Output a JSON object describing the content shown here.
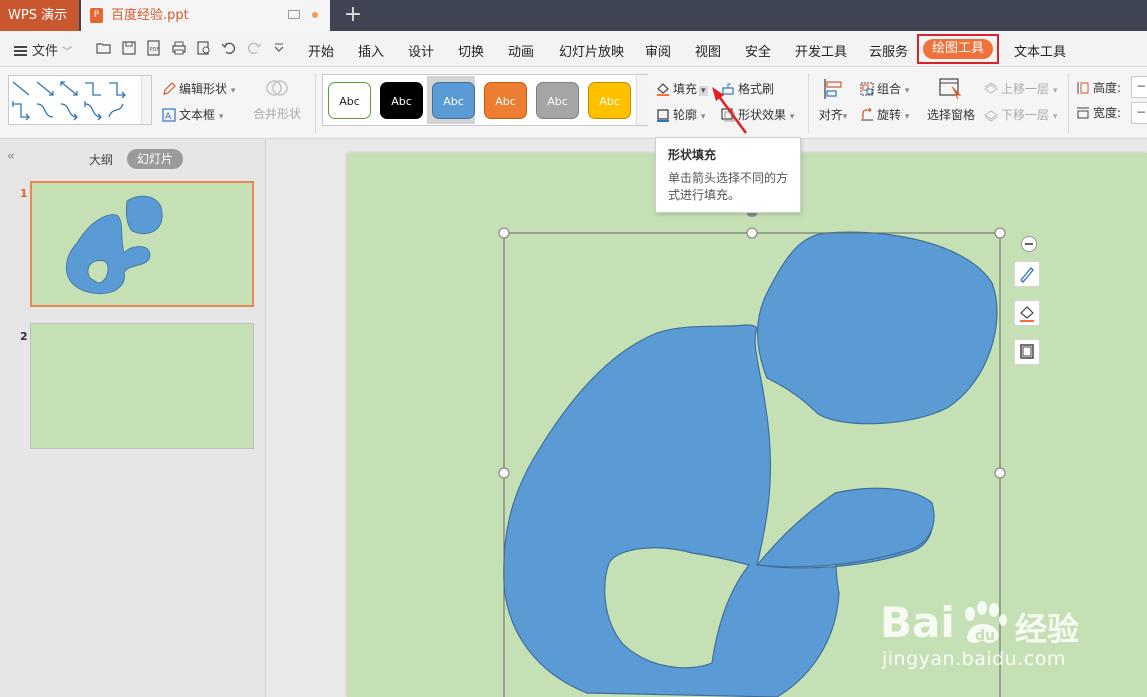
{
  "titlebar": {
    "app_name": "WPS 演示",
    "document_tab": "百度经验.ppt",
    "new_tab": "+"
  },
  "menubar": {
    "file": "文件",
    "items": [
      "开始",
      "插入",
      "设计",
      "切换",
      "动画",
      "幻灯片放映",
      "审阅",
      "视图",
      "安全",
      "开发工具",
      "云服务"
    ],
    "active_tab": "绘图工具",
    "after_active": "文本工具"
  },
  "ribbon": {
    "edit_shape": "编辑形状",
    "text_box": "文本框",
    "merge_shape": "合并形状",
    "styles": [
      {
        "label": "Abc",
        "fill": "#ffffff",
        "border": "#5a9e3a",
        "text": "#222222"
      },
      {
        "label": "Abc",
        "fill": "#000000",
        "border": "#000000",
        "text": "#ffffff"
      },
      {
        "label": "Abc",
        "fill": "#5b9bd5",
        "border": "#41719c",
        "text": "#ffffff"
      },
      {
        "label": "Abc",
        "fill": "#ed7d31",
        "border": "#c55a11",
        "text": "#ffffff"
      },
      {
        "label": "Abc",
        "fill": "#a5a5a5",
        "border": "#7f7f7f",
        "text": "#ffffff"
      },
      {
        "label": "Abc",
        "fill": "#ffc000",
        "border": "#bf9000",
        "text": "#ffffff"
      }
    ],
    "fill": "填充",
    "format_painter": "格式刷",
    "outline": "轮廓",
    "shape_effect": "形状效果",
    "align": "对齐",
    "group": "组合",
    "rotate": "旋转",
    "selection_pane": "选择窗格",
    "bring_forward": "上移一层",
    "send_backward": "下移一层",
    "height_label": "高度:",
    "width_label": "宽度:"
  },
  "tooltip": {
    "title": "形状填充",
    "body": "单击箭头选择不同的方式进行填充。"
  },
  "leftpanel": {
    "collapse": "«",
    "tab_outline": "大纲",
    "tab_slides": "幻灯片",
    "slides": [
      {
        "num": "1"
      },
      {
        "num": "2"
      }
    ]
  },
  "watermark": {
    "brand": "Bai",
    "brand_cn": "经验",
    "url": "jingyan.baidu.com"
  },
  "colors": {
    "accent_orange": "#f0713a",
    "highlight_red": "#d9232a",
    "slide_green": "#c6e0b5",
    "shape_blue": "#5b9bd5",
    "shape_stroke": "#3e6f9a",
    "arrow_red": "#e02020"
  }
}
